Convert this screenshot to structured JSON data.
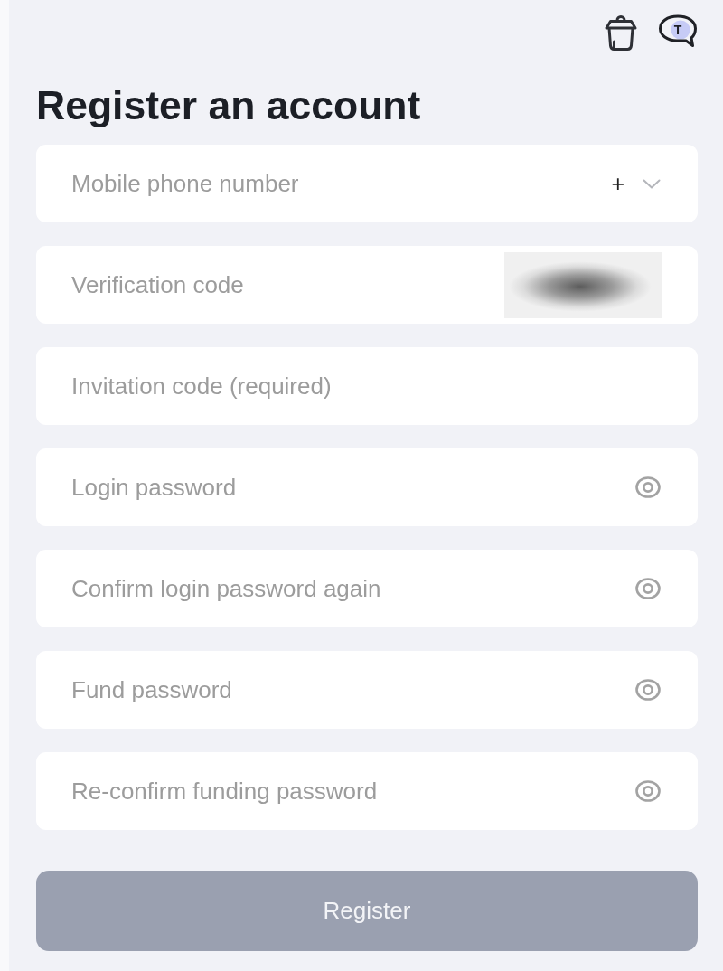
{
  "header": {
    "chat_letter": "T"
  },
  "title": "Register an account",
  "fields": [
    {
      "kind": "phone",
      "placeholder": "Mobile phone number",
      "prefix": "+"
    },
    {
      "kind": "captcha",
      "placeholder": "Verification code"
    },
    {
      "kind": "text",
      "placeholder": "Invitation code (required)"
    },
    {
      "kind": "password",
      "placeholder": "Login password"
    },
    {
      "kind": "password",
      "placeholder": "Confirm login password again"
    },
    {
      "kind": "password",
      "placeholder": "Fund password"
    },
    {
      "kind": "password",
      "placeholder": "Re-confirm funding password"
    }
  ],
  "register_button": {
    "label": "Register",
    "disabled": true
  }
}
